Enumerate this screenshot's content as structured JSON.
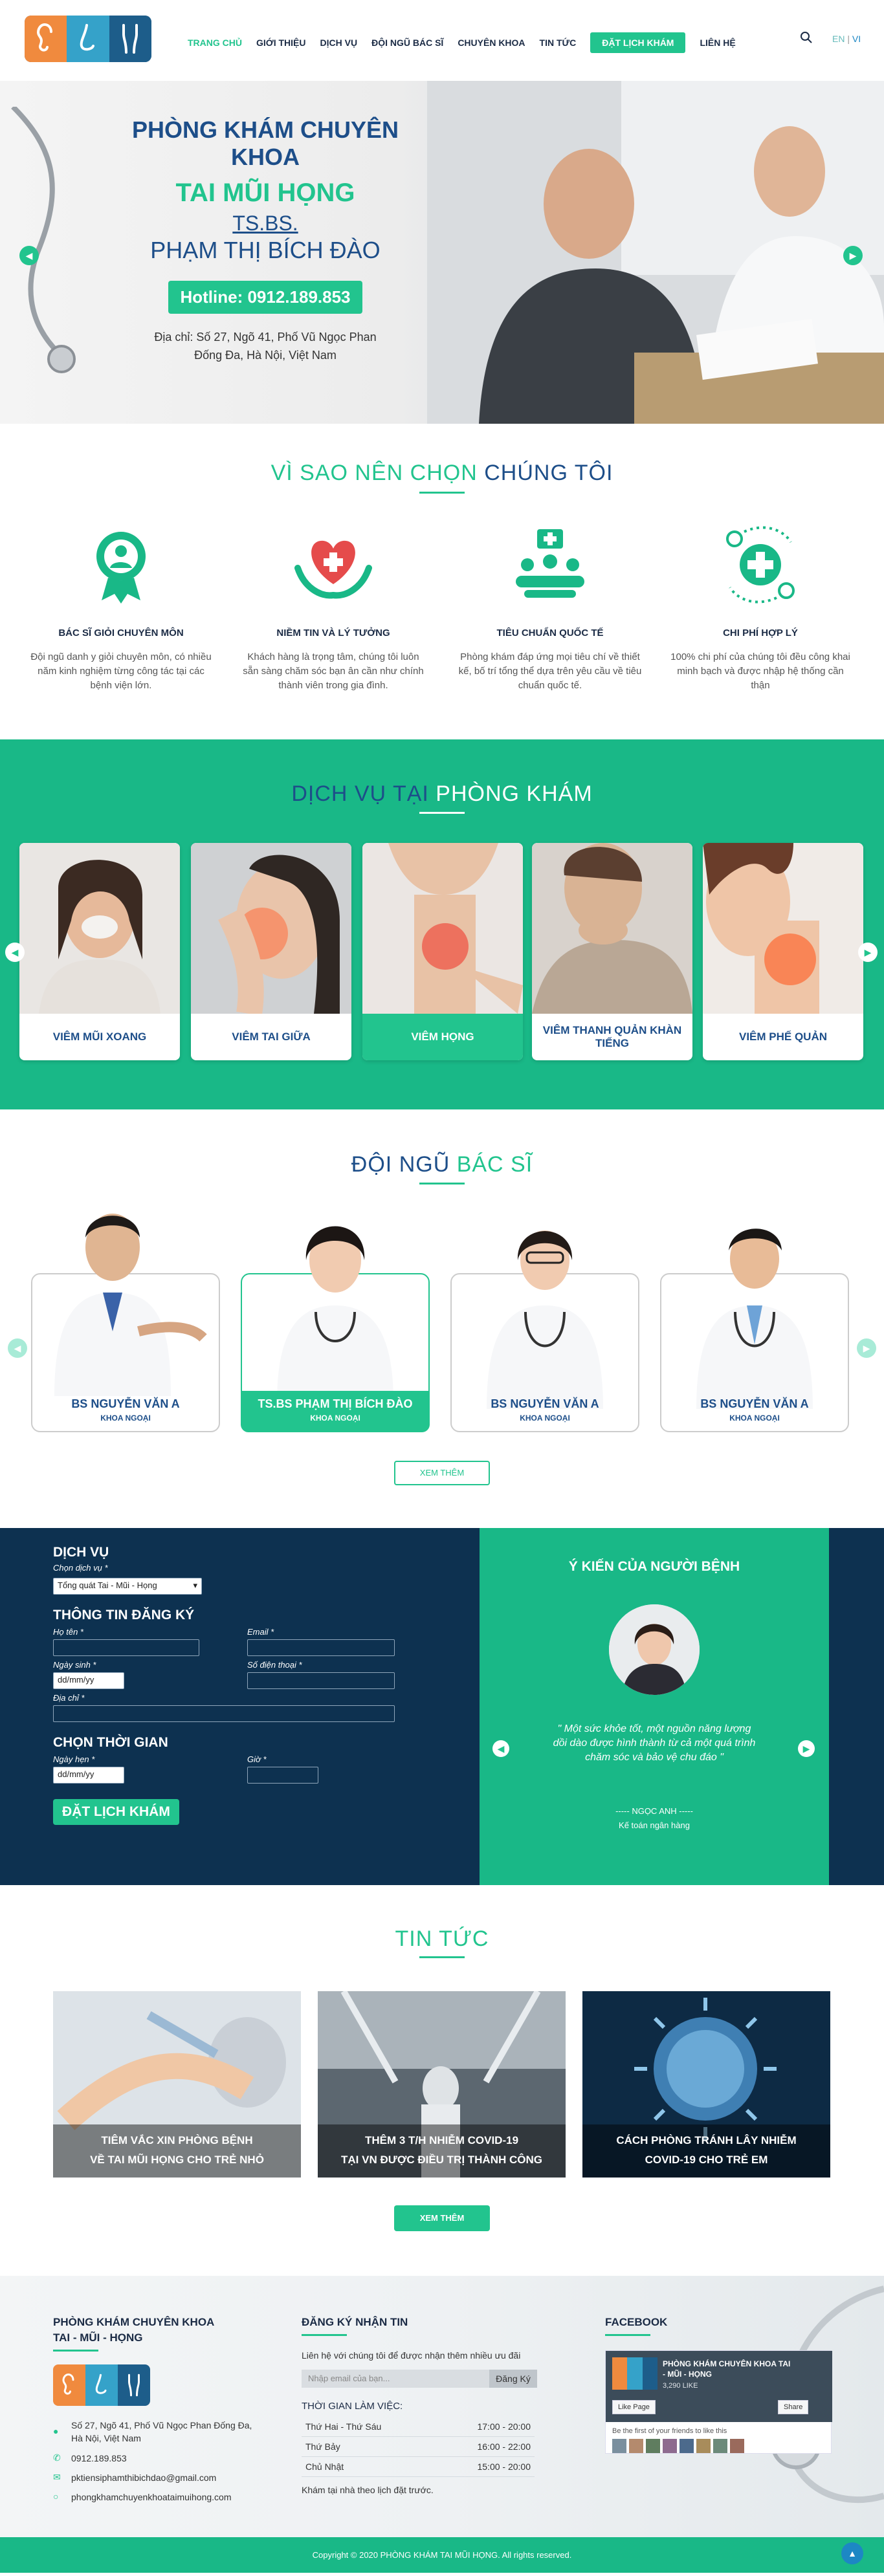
{
  "nav": {
    "items": [
      "TRANG CHỦ",
      "GIỚI THIỆU",
      "DỊCH VỤ",
      "ĐỘI NGŨ BÁC SĨ",
      "CHUYÊN KHOA",
      "TIN TỨC"
    ],
    "book": "ĐẶT LỊCH KHÁM",
    "contact": "LIÊN HỆ",
    "lang_en": "EN",
    "lang_sep": "|",
    "lang_vi": "VI"
  },
  "hero": {
    "line1": "PHÒNG KHÁM CHUYÊN KHOA",
    "line2": "TAI MŨI HỌNG",
    "line3": "TS.BS.",
    "line4": "PHẠM THỊ BÍCH ĐÀO",
    "hotline": "Hotline: 0912.189.853",
    "address1": "Địa chỉ: Số 27, Ngõ 41, Phố Vũ Ngọc Phan",
    "address2": "Đống Đa, Hà Nội, Việt Nam"
  },
  "why": {
    "title_a": "VÌ SAO NÊN ",
    "title_b": "CHỌN ",
    "title_c": "CHÚNG TÔI",
    "items": [
      {
        "title": "BÁC SĨ GIỎI CHUYÊN MÔN",
        "desc": "Đội ngũ danh y giỏi chuyên môn, có nhiều năm kinh nghiệm từng công tác tại các bệnh viện lớn."
      },
      {
        "title": "NIỀM TIN VÀ LÝ TƯỞNG",
        "desc": "Khách hàng là trọng tâm, chúng tôi luôn sẵn sàng chăm sóc bạn ân cần như chính thành viên trong gia đình."
      },
      {
        "title": "TIÊU CHUẨN QUỐC TẾ",
        "desc": "Phòng khám đáp ứng mọi tiêu chí về thiết kế, bố trí tổng thể dựa trên yêu cầu về tiêu chuẩn quốc tế."
      },
      {
        "title": "CHI PHÍ HỢP LÝ",
        "desc": "100% chi phí của chúng tôi đều công khai minh bạch và được nhập hệ thống cần thận"
      }
    ]
  },
  "services": {
    "title_a": "DỊCH VỤ TẠI ",
    "title_b": "PHÒNG KHÁM",
    "items": [
      "VIÊM MŨI XOANG",
      "VIÊM TAI GIỮA",
      "VIÊM HỌNG",
      "VIÊM THANH QUẢN KHÀN TIẾNG",
      "VIÊM PHẾ QUẢN"
    ]
  },
  "doctors": {
    "title_a": "ĐỘI NGŨ ",
    "title_b": "BÁC SĨ",
    "items": [
      {
        "name": "BS NGUYỄN VĂN A",
        "dept": "KHOA NGOẠI"
      },
      {
        "name": "TS.BS PHẠM THỊ BÍCH ĐÀO",
        "dept": "KHOA NGOẠI"
      },
      {
        "name": "BS NGUYỄN VĂN A",
        "dept": "KHOA NGOẠI"
      },
      {
        "name": "BS NGUYỄN VĂN A",
        "dept": "KHOA NGOẠI"
      }
    ],
    "more": "XEM THÊM"
  },
  "form": {
    "service_h": "DỊCH VỤ",
    "service_lbl": "Chọn dịch vụ *",
    "service_val": "Tổng quát Tai - Mũi - Họng",
    "reg_h": "THÔNG TIN ĐĂNG KÝ",
    "name_lbl": "Họ tên *",
    "email_lbl": "Email *",
    "dob_lbl": "Ngày sinh *",
    "phone_lbl": "Số điện thoại *",
    "date_ph": "dd/mm/yy",
    "addr_lbl": "Địa chỉ *",
    "time_h": "CHỌN THỜI GIAN",
    "appt_lbl": "Ngày hẹn *",
    "hour_lbl": "Giờ *",
    "submit": "ĐẶT LỊCH KHÁM"
  },
  "testimonial": {
    "title": "Ý KIẾN CỦA NGƯỜI BỆNH",
    "quote": "\" Một sức khỏe tốt, một nguồn năng lượng dồi dào được hình thành từ cả một quá trình chăm sóc và bảo vệ chu đáo \"",
    "name": "----- NGỌC ANH -----",
    "role": "Kế toán ngân hàng"
  },
  "news": {
    "title": "TIN TỨC",
    "items": [
      {
        "l1": "TIÊM VẮC XIN PHÒNG BỆNH",
        "l2": "VỀ TAI MŨI HỌNG CHO TRẺ NHỎ"
      },
      {
        "l1": "THÊM 3 T/H NHIỄM COVID-19",
        "l2": "TẠI VN ĐƯỢC ĐIỀU TRỊ THÀNH CÔNG"
      },
      {
        "l1": "CÁCH PHÒNG TRÁNH LÂY NHIỄM",
        "l2": "COVID-19 CHO TRẺ EM"
      }
    ],
    "more": "XEM THÊM"
  },
  "footer": {
    "clinic_l1": "PHÒNG KHÁM CHUYÊN KHOA",
    "clinic_l2": "TAI - MŨI - HỌNG",
    "addr": "Số 27, Ngõ 41, Phố Vũ Ngọc Phan Đống Đa, Hà Nội, Việt Nam",
    "phone": "0912.189.853",
    "email": "pktiensiphamthibichdao@gmail.com",
    "web": "phongkhamchuyenkhoataimuihong.com",
    "news_h": "ĐĂNG KÝ NHẬN TIN",
    "news_desc": "Liên hệ với chúng tôi để được nhận thêm nhiều ưu đãi",
    "email_ph": "Nhập email của bạn...",
    "subscribe": "Đăng Ký",
    "hours_h": "THỜI GIAN LÀM VIỆC:",
    "hours": [
      {
        "day": "Thứ Hai - Thứ Sáu",
        "time": "17:00 - 20:00"
      },
      {
        "day": "Thứ Bảy",
        "time": "16:00 - 22:00"
      },
      {
        "day": "Chủ Nhật",
        "time": "15:00 - 20:00"
      }
    ],
    "appt_note": "Khám tại nhà theo lịch đặt trước.",
    "fb_h": "FACEBOOK",
    "fb_name": "PHÒNG KHÁM CHUYÊN KHOA TAI - MŨI - HỌNG",
    "fb_likes": "3,290 LIKE",
    "fb_like_btn": "Like Page",
    "fb_share": "Share",
    "fb_friends": "Be the first of your friends to like this",
    "copyright": "Copyright © 2020 PHÒNG KHÁM TAI MŨI HỌNG. All rights reserved."
  }
}
